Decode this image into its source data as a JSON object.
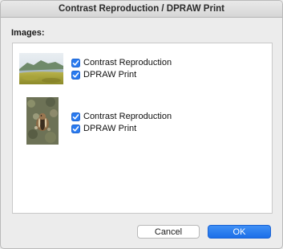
{
  "window": {
    "title": "Contrast Reproduction / DPRAW Print"
  },
  "images_section": {
    "label": "Images:",
    "items": [
      {
        "thumbnail_icon": "landscape-photo-thumbnail",
        "options": [
          {
            "label": "Contrast Reproduction",
            "checked": true
          },
          {
            "label": "DPRAW Print",
            "checked": true
          }
        ]
      },
      {
        "thumbnail_icon": "chipmunk-photo-thumbnail",
        "options": [
          {
            "label": "Contrast Reproduction",
            "checked": true
          },
          {
            "label": "DPRAW Print",
            "checked": true
          }
        ]
      }
    ]
  },
  "buttons": {
    "cancel_label": "Cancel",
    "ok_label": "OK"
  },
  "colors": {
    "accent": "#2a7bf0",
    "dialog_bg": "#ececec"
  }
}
